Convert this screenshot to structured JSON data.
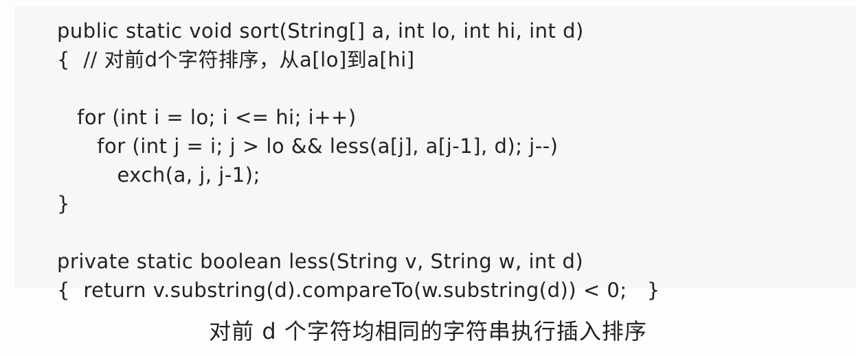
{
  "code": {
    "lines": [
      "public static void sort(String[] a, int lo, int hi, int d)",
      "{  // 对前d个字符排序，从a[lo]到a[hi]",
      "",
      "   for (int i = lo; i <= hi; i++)",
      "      for (int j = i; j > lo && less(a[j], a[j-1], d); j--)",
      "         exch(a, j, j-1);",
      "}",
      "",
      "private static boolean less(String v, String w, int d)",
      "{  return v.substring(d).compareTo(w.substring(d)) < 0;   }"
    ]
  },
  "caption": "对前 d 个字符均相同的字符串执行插入排序"
}
